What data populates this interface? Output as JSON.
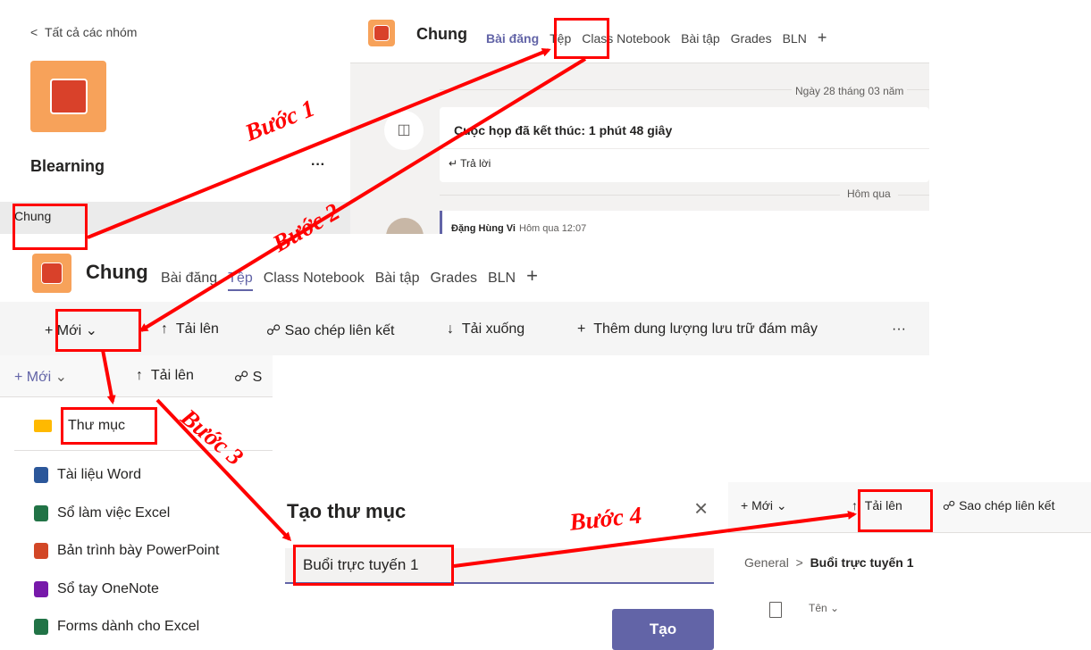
{
  "left_panel": {
    "back_label": "Tất cả các nhóm",
    "team_name": "Blearning",
    "more": "···",
    "channel": "Chung"
  },
  "top_window": {
    "channel": "Chung",
    "tabs": [
      "Bài đăng",
      "Tệp",
      "Class Notebook",
      "Bài tập",
      "Grades",
      "BLN"
    ],
    "plus": "+",
    "date": "Ngày 28 tháng 03 năm",
    "meeting": "Cuộc họp đã kết thúc: 1 phút 48 giây",
    "reply": "Trả lời",
    "yesterday": "Hôm qua",
    "author": "Đặng Hùng Vi",
    "author_time": "Hôm qua 12:07"
  },
  "files_window": {
    "channel": "Chung",
    "tabs": [
      "Bài đăng",
      "Tệp",
      "Class Notebook",
      "Bài tập",
      "Grades",
      "BLN"
    ],
    "plus": "+",
    "toolbar": {
      "new": "Mới",
      "upload": "Tải lên",
      "copy_link": "Sao chép liên kết",
      "download": "Tải xuống",
      "add_storage": "Thêm dung lượng lưu trữ đám mây",
      "more": "···"
    }
  },
  "new_menu": {
    "toolbar": {
      "new": "Mới",
      "upload": "Tải lên",
      "copy_link_fragment": "S"
    },
    "items": [
      {
        "label": "Thư mục",
        "icon": "folder-icon",
        "color": "#ffb900"
      },
      {
        "label": "Tài liệu Word",
        "icon": "word-icon",
        "color": "#2b579a"
      },
      {
        "label": "Sổ làm việc Excel",
        "icon": "excel-icon",
        "color": "#217346"
      },
      {
        "label": "Bản trình bày PowerPoint",
        "icon": "powerpoint-icon",
        "color": "#d24726"
      },
      {
        "label": "Sổ tay OneNote",
        "icon": "onenote-icon",
        "color": "#7719aa"
      },
      {
        "label": "Forms dành cho Excel",
        "icon": "forms-excel-icon",
        "color": "#217346"
      }
    ]
  },
  "create_folder_dialog": {
    "title": "Tạo thư mục",
    "input_value": "Buổi trực tuyến 1",
    "create_button": "Tạo",
    "button_color": "#6264a7"
  },
  "result_panel": {
    "toolbar": {
      "new": "Mới",
      "upload": "Tải lên",
      "copy_link": "Sao chép liên kết"
    },
    "breadcrumb_root": "General",
    "breadcrumb_current": "Buổi trực tuyến 1",
    "column_name": "Tên"
  },
  "steps": [
    "Bước 1",
    "Bước 2",
    "Bước 3",
    "Bước 4"
  ],
  "colors": {
    "annotation": "#ff0000",
    "accent": "#6264a7",
    "app_icon": "#f7a25a"
  }
}
